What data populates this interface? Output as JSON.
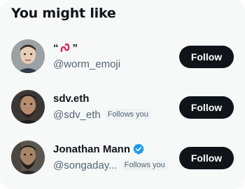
{
  "panel": {
    "title": "You might like"
  },
  "suggestions": [
    {
      "display_name": "“🪱”",
      "display_name_text": "“ ”",
      "handle": "@worm_emoji",
      "follows_you": "",
      "verified": false,
      "follow_label": "Follow"
    },
    {
      "display_name": "sdv.eth",
      "handle": "@sdv_eth",
      "follows_you": "Follows you",
      "verified": false,
      "follow_label": "Follow"
    },
    {
      "display_name": "Jonathan Mann",
      "handle": "@songaday...",
      "follows_you": "Follows you",
      "verified": true,
      "follow_label": "Follow"
    }
  ],
  "colors": {
    "button_bg": "#0f1419",
    "verified_blue": "#1d9bf0",
    "worm": "#e0245e"
  }
}
